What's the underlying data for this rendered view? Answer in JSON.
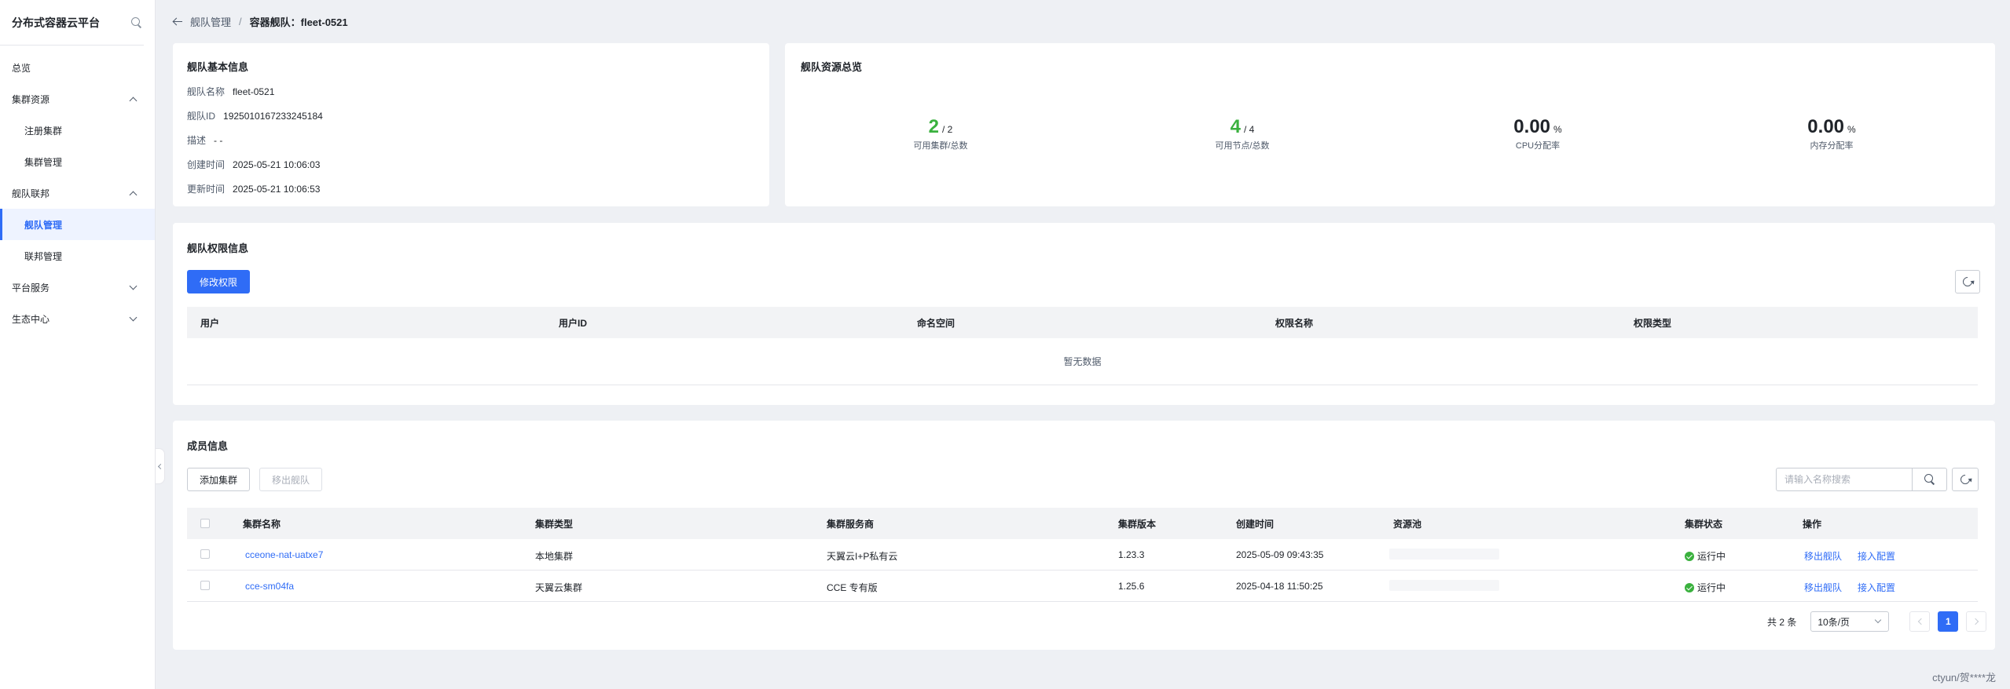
{
  "app": {
    "title": "分布式容器云平台"
  },
  "sidebar": {
    "items": [
      {
        "label": "总览"
      },
      {
        "label": "集群资源"
      },
      {
        "label": "注册集群"
      },
      {
        "label": "集群管理"
      },
      {
        "label": "舰队联邦"
      },
      {
        "label": "舰队管理"
      },
      {
        "label": "联邦管理"
      },
      {
        "label": "平台服务"
      },
      {
        "label": "生态中心"
      }
    ]
  },
  "breadcrumb": {
    "parent": "舰队管理",
    "separator": "/",
    "current": "容器舰队：fleet-0521"
  },
  "basic_info": {
    "title": "舰队基本信息",
    "rows": [
      {
        "label": "舰队名称",
        "value": "fleet-0521"
      },
      {
        "label": "舰队ID",
        "value": "1925010167233245184"
      },
      {
        "label": "描述",
        "value": "- -"
      },
      {
        "label": "创建时间",
        "value": "2025-05-21 10:06:03"
      },
      {
        "label": "更新时间",
        "value": "2025-05-21 10:06:53"
      }
    ]
  },
  "resource_overview": {
    "title": "舰队资源总览",
    "stats": [
      {
        "value": "2",
        "suffix": "/ 2",
        "label": "可用集群/总数"
      },
      {
        "value": "4",
        "suffix": "/ 4",
        "label": "可用节点/总数"
      },
      {
        "value": "0.00",
        "suffix": "%",
        "label": "CPU分配率"
      },
      {
        "value": "0.00",
        "suffix": "%",
        "label": "内存分配率"
      }
    ]
  },
  "permission": {
    "title": "舰队权限信息",
    "edit_button": "修改权限",
    "columns": [
      "用户",
      "用户ID",
      "命名空间",
      "权限名称",
      "权限类型"
    ],
    "empty_text": "暂无数据"
  },
  "members": {
    "title": "成员信息",
    "add_button": "添加集群",
    "remove_button": "移出舰队",
    "search_placeholder": "请输入名称搜索",
    "columns": [
      "集群名称",
      "集群类型",
      "集群服务商",
      "集群版本",
      "创建时间",
      "资源池",
      "集群状态",
      "操作"
    ],
    "rows": [
      {
        "name": "cceone-nat-uatxe7",
        "type": "本地集群",
        "provider": "天翼云I+P私有云",
        "version": "1.23.3",
        "created": "2025-05-09 09:43:35",
        "status": "运行中",
        "action_remove": "移出舰队",
        "action_config": "接入配置"
      },
      {
        "name": "cce-sm04fa",
        "type": "天翼云集群",
        "provider": "CCE 专有版",
        "version": "1.25.6",
        "created": "2025-04-18 11:50:25",
        "status": "运行中",
        "action_remove": "移出舰队",
        "action_config": "接入配置"
      }
    ],
    "pagination": {
      "total_text": "共 2 条",
      "page_size": "10条/页",
      "current_page": "1"
    }
  },
  "watermark": "ctyun/贺****龙",
  "colors": {
    "primary": "#2f6cf6",
    "success": "#3ab13e",
    "background": "#eef0f4"
  }
}
